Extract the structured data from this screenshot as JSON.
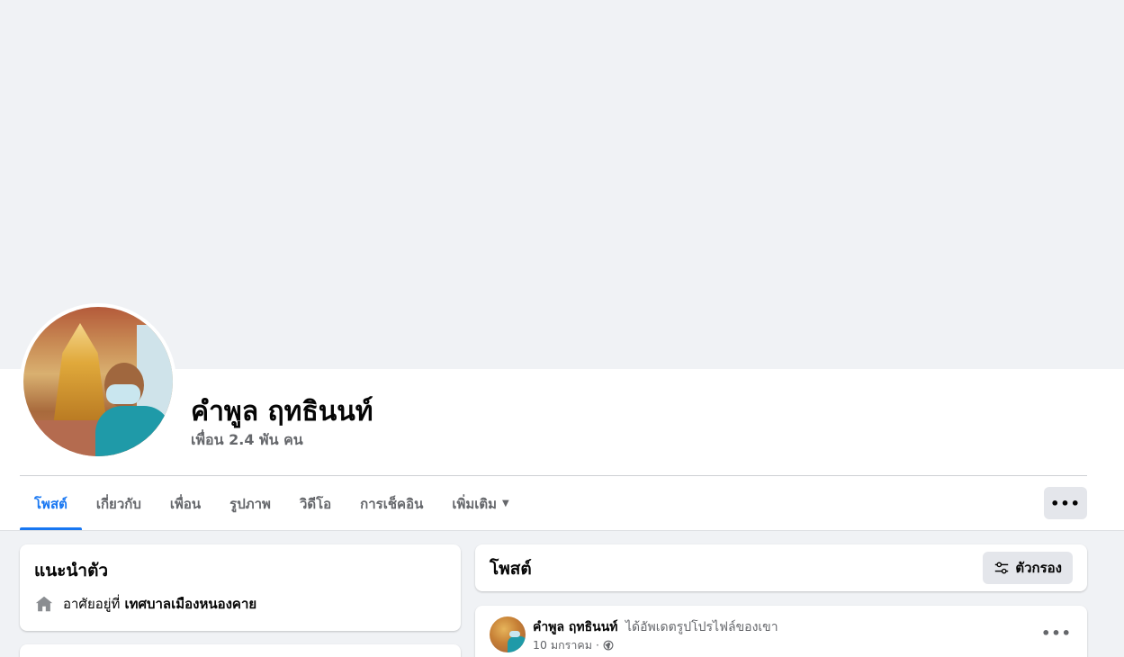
{
  "profile": {
    "name": "คำพูล ฤทธินนท์",
    "friends_count": "เพื่อน 2.4 พัน คน"
  },
  "tabs": [
    {
      "label": "โพสต์",
      "active": true
    },
    {
      "label": "เกี่ยวกับ"
    },
    {
      "label": "เพื่อน"
    },
    {
      "label": "รูปภาพ"
    },
    {
      "label": "วิดีโอ"
    },
    {
      "label": "การเช็คอิน"
    },
    {
      "label": "เพิ่มเติม"
    }
  ],
  "more_button": "•••",
  "intro": {
    "title": "แนะนำตัว",
    "lives_in_prefix": "อาศัยอยู่ที่",
    "lives_in_place": "เทศบาลเมืองหนองคาย",
    "icon": "home-icon"
  },
  "posts": {
    "title": "โพสต์",
    "filter_label": "ตัวกรอง",
    "filter_icon": "filter-icon"
  },
  "post": {
    "author": "คำพูล ฤทธินนท์",
    "action": "ได้อัพเดตรูปโปรไฟล์ของเขา",
    "date": "10 มกราคม ·",
    "privacy_icon": "globe-icon",
    "more": "•••"
  },
  "colors": {
    "accent": "#1877f2",
    "background": "#f0f2f5",
    "secondary_text": "#65676b"
  }
}
